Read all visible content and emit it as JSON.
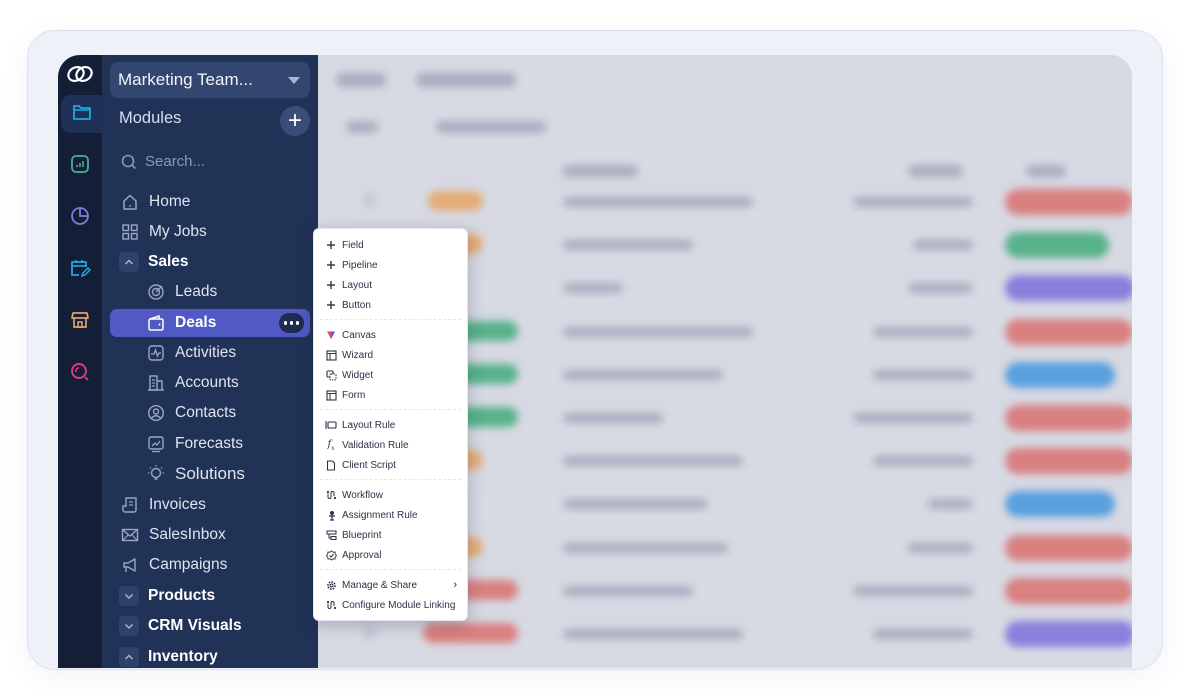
{
  "sidebar": {
    "org_name": "Marketing Team...",
    "modules_label": "Modules",
    "search_placeholder": "Search...",
    "items": [
      {
        "label": "Home",
        "icon": "home-icon"
      },
      {
        "label": "My Jobs",
        "icon": "grid-icon"
      },
      {
        "label": "Sales",
        "icon": "chevron-up-icon",
        "type": "group"
      },
      {
        "label": "Leads",
        "icon": "target-icon"
      },
      {
        "label": "Deals",
        "icon": "wallet-icon",
        "active": true
      },
      {
        "label": "Activities",
        "icon": "activity-icon"
      },
      {
        "label": "Accounts",
        "icon": "building-icon"
      },
      {
        "label": "Contacts",
        "icon": "user-circle-icon"
      },
      {
        "label": "Forecasts",
        "icon": "chart-trend-icon"
      },
      {
        "label": "Solutions",
        "icon": "lightbulb-icon"
      },
      {
        "label": "Invoices",
        "icon": "invoice-icon"
      },
      {
        "label": "SalesInbox",
        "icon": "mail-icon"
      },
      {
        "label": "Campaigns",
        "icon": "megaphone-icon"
      },
      {
        "label": "Products",
        "icon": "chevron-down-icon",
        "type": "group"
      },
      {
        "label": "CRM Visuals",
        "icon": "chevron-down-icon",
        "type": "group"
      },
      {
        "label": "Inventory",
        "icon": "chevron-up-icon",
        "type": "group"
      }
    ]
  },
  "rail": {
    "items": [
      "logo-icon",
      "folder-icon",
      "analytics-icon",
      "pie-chart-icon",
      "calendar-edit-icon",
      "store-icon",
      "search-icon"
    ],
    "colors": {
      "folder": "#22a7e0",
      "analytics": "#49b08f",
      "pie": "#7b7fe0",
      "calendar": "#22a7e0",
      "store": "#e0a46c",
      "search": "#e03c7a"
    }
  },
  "context_menu": {
    "groups": [
      [
        {
          "label": "Field",
          "icon": "plus-icon"
        },
        {
          "label": "Pipeline",
          "icon": "plus-icon"
        },
        {
          "label": "Layout",
          "icon": "plus-icon"
        },
        {
          "label": "Button",
          "icon": "plus-icon"
        }
      ],
      [
        {
          "label": "Canvas",
          "icon": "canvas-icon"
        },
        {
          "label": "Wizard",
          "icon": "wizard-icon"
        },
        {
          "label": "Widget",
          "icon": "widget-icon"
        },
        {
          "label": "Form",
          "icon": "form-icon"
        }
      ],
      [
        {
          "label": "Layout Rule",
          "icon": "layout-rule-icon"
        },
        {
          "label": "Validation Rule",
          "icon": "function-icon"
        },
        {
          "label": "Client Script",
          "icon": "file-icon"
        }
      ],
      [
        {
          "label": "Workflow",
          "icon": "workflow-icon"
        },
        {
          "label": "Assignment Rule",
          "icon": "assignment-icon"
        },
        {
          "label": "Blueprint",
          "icon": "blueprint-icon"
        },
        {
          "label": "Approval",
          "icon": "approval-icon"
        }
      ],
      [
        {
          "label": "Manage & Share",
          "icon": "gear-icon",
          "submenu": true
        },
        {
          "label": "Configure Module Linking",
          "icon": "workflow-icon"
        }
      ]
    ]
  },
  "background": {
    "blurred": true,
    "stage_colors": [
      "#d98080",
      "#58b28a",
      "#8a80dd",
      "#d98080",
      "#5aa0e0",
      "#d98080",
      "#d98080",
      "#5aa0e0",
      "#d98080",
      "#d98080",
      "#8a80dd"
    ],
    "tag_colors": [
      "#e3ad78",
      "#e3ad78",
      null,
      "#58b28a",
      "#58b28a",
      "#58b28a",
      "#e3ad78",
      null,
      "#e3ad78",
      "#d98080",
      "#d98080"
    ]
  }
}
